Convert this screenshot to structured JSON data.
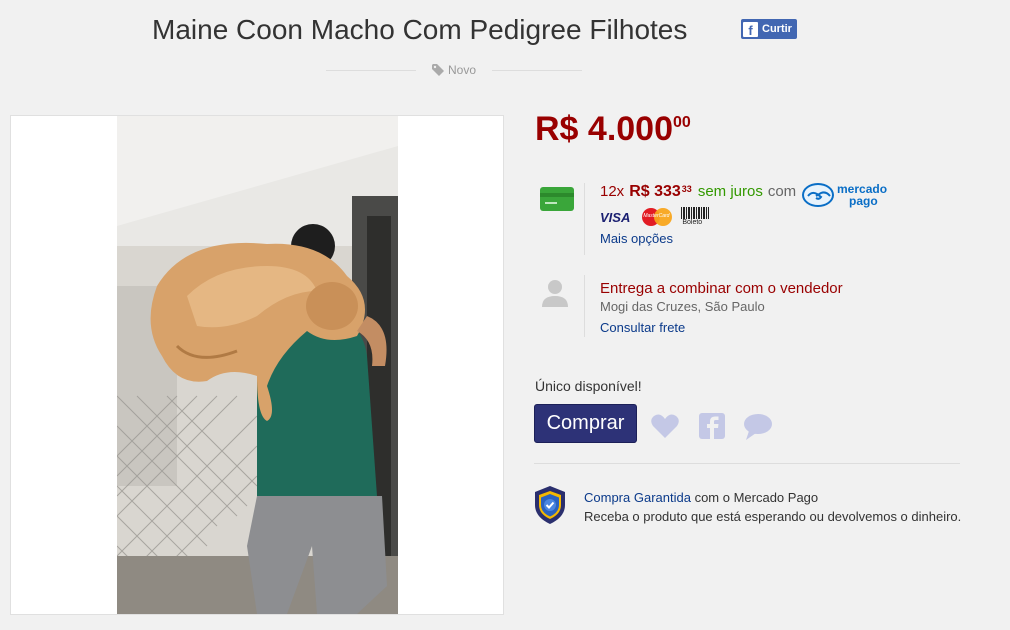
{
  "header": {
    "title": "Maine Coon Macho Com Pedigree Filhotes",
    "like_label": "Curtir",
    "condition": "Novo"
  },
  "price": {
    "currency": "R$",
    "integer": "4.000",
    "cents": "00"
  },
  "installments": {
    "count": "12x",
    "currency": "R$",
    "integer": "333",
    "cents": "33",
    "no_interest": "sem juros",
    "with": "com",
    "provider_line1": "mercado",
    "provider_line2": "pago",
    "methods": {
      "visa": "VISA",
      "mastercard": "MasterCard",
      "boleto": "Boleto"
    },
    "more_options": "Mais opções"
  },
  "delivery": {
    "title": "Entrega a combinar com o vendedor",
    "location": "Mogi das Cruzes, São Paulo",
    "shipping_link": "Consultar frete"
  },
  "stock": {
    "label": "Único disponível!"
  },
  "actions": {
    "buy_label": "Comprar"
  },
  "guarantee": {
    "link": "Compra Garantida",
    "suffix": " com o Mercado Pago",
    "description": "Receba o produto que está esperando ou devolvemos o dinheiro."
  },
  "icons": {
    "like": "facebook-f-icon",
    "condition": "tag-icon",
    "card": "credit-card-icon",
    "delivery": "person-icon",
    "favorite": "heart-icon",
    "share": "facebook-icon",
    "question": "chat-bubble-icon",
    "guarantee": "shield-check-icon"
  },
  "colors": {
    "price": "#990000",
    "no_interest": "#339900",
    "link": "#0b3a8a",
    "buy_button": "#2d3277",
    "action_icons": "#c4c8e6",
    "facebook": "#4267b2"
  }
}
